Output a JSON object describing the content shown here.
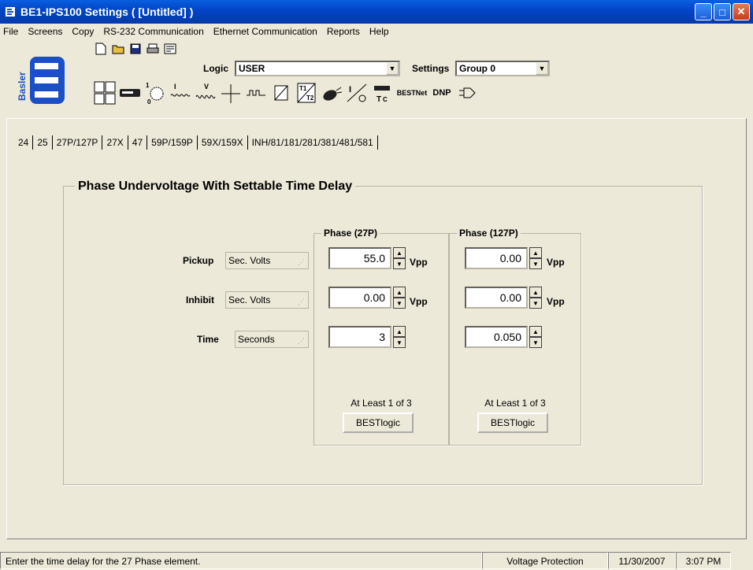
{
  "window": {
    "title": "BE1-IPS100 Settings    ( [Untitled] )"
  },
  "menu": [
    "File",
    "Screens",
    "Copy",
    "RS-232 Communication",
    "Ethernet Communication",
    "Reports",
    "Help"
  ],
  "toolbar": {
    "logic_label": "Logic",
    "logic_value": "USER",
    "settings_label": "Settings",
    "settings_value": "Group 0",
    "bestnet_label": "BESTNet",
    "dnp_label": "DNP"
  },
  "tabs": [
    "24",
    "25",
    "27P/127P",
    "27X",
    "47",
    "59P/159P",
    "59X/159X",
    "INH/81/181/281/381/481/581"
  ],
  "active_tab": "27P/127P",
  "group_title": "Phase Undervoltage With Settable Time Delay",
  "rows": {
    "pickup": {
      "label": "Pickup",
      "unit": "Sec. Volts"
    },
    "inhibit": {
      "label": "Inhibit",
      "unit": "Sec. Volts"
    },
    "time": {
      "label": "Time",
      "unit": "Seconds"
    }
  },
  "phase27": {
    "title": "Phase (27P)",
    "pickup": "55.0",
    "inhibit": "0.00",
    "time": "3",
    "unit": "Vpp",
    "note": "At Least 1 of 3",
    "button": "BESTlogic"
  },
  "phase127": {
    "title": "Phase (127P)",
    "pickup": "0.00",
    "inhibit": "0.00",
    "time": "0.050",
    "unit": "Vpp",
    "note": "At Least 1 of 3",
    "button": "BESTlogic"
  },
  "status": {
    "message": "Enter the time delay for the 27 Phase element.",
    "section": "Voltage Protection",
    "date": "11/30/2007",
    "time": "3:07 PM"
  },
  "logo_text": "Basler"
}
